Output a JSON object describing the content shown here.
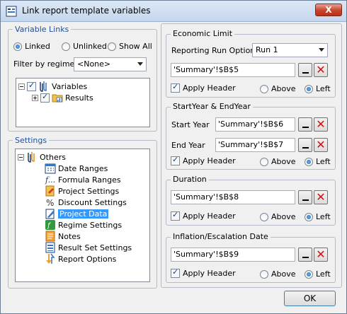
{
  "window": {
    "title": "Link report template variables",
    "close_label": "X"
  },
  "variable_links": {
    "legend": "Variable Links",
    "radios": [
      "Linked",
      "Unlinked",
      "Show All"
    ],
    "selected_radio": "Linked",
    "filter_label": "Filter by regime:",
    "filter_value": "<None>",
    "tree": [
      {
        "label": "Variables",
        "checked": true
      },
      {
        "label": "Results",
        "checked": true
      }
    ]
  },
  "settings": {
    "legend": "Settings",
    "root": "Others",
    "items": [
      "Date Ranges",
      "Formula Ranges",
      "Project Settings",
      "Discount Settings",
      "Project Data",
      "Regime Settings",
      "Notes",
      "Result Set Settings",
      "Report Options"
    ],
    "selected": "Project Data"
  },
  "economic_limit": {
    "legend": "Economic Limit",
    "run_option_label": "Reporting Run Option:",
    "run_option_value": "Run 1",
    "cell": "'Summary'!$B$5",
    "apply_header": "Apply Header",
    "above": "Above",
    "left": "Left"
  },
  "start_end_year": {
    "legend": "StartYear & EndYear",
    "start_label": "Start Year",
    "start_cell": "'Summary'!$B$6",
    "end_label": "End Year",
    "end_cell": "'Summary'!$B$7",
    "apply_header": "Apply Header",
    "above": "Above",
    "left": "Left"
  },
  "duration": {
    "legend": "Duration",
    "cell": "'Summary'!$B$8",
    "apply_header": "Apply Header",
    "above": "Above",
    "left": "Left"
  },
  "inflation": {
    "legend": "Inflation/Escalation Date",
    "cell": "'Summary'!$B$9",
    "apply_header": "Apply Header",
    "above": "Above",
    "left": "Left"
  },
  "ok_label": "OK",
  "colors": {
    "accent": "#3399ff",
    "legend_blue": "#1d4f9a",
    "delete_red": "#d40e0e"
  }
}
